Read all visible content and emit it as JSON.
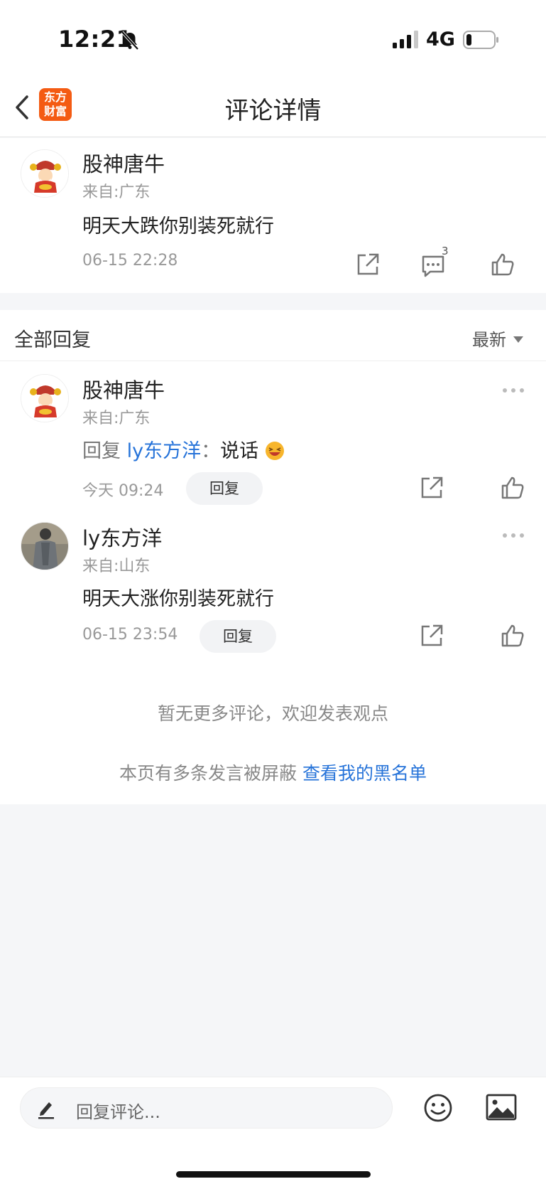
{
  "status_bar": {
    "time": "12:21",
    "network": "4G"
  },
  "nav": {
    "logo_line1": "东方",
    "logo_line2": "财富",
    "title": "评论详情"
  },
  "main_comment": {
    "username": "股神唐牛",
    "location": "来自:广东",
    "text": "明天大跌你别装死就行",
    "time": "06-15 22:28",
    "reply_count": "3"
  },
  "replies": {
    "header": "全部回复",
    "sort_label": "最新",
    "items": [
      {
        "username": "股神唐牛",
        "location": "来自:广东",
        "reply_prefix": "回复 ",
        "mention": "ly东方洋",
        "colon": "：",
        "text": "说话",
        "time": "今天 09:24",
        "reply_label": "回复"
      },
      {
        "username": "ly东方洋",
        "location": "来自:山东",
        "text": "明天大涨你别装死就行",
        "time": "06-15 23:54",
        "reply_label": "回复"
      }
    ],
    "no_more": "暂无更多评论，欢迎发表观点",
    "blocked_note": "本页有多条发言被屏蔽 ",
    "blacklist_link": "查看我的黑名单"
  },
  "bottom_bar": {
    "input_placeholder": "回复评论..."
  },
  "colors": {
    "brand": "#f45b13",
    "link": "#2673d9",
    "muted": "#999999"
  }
}
